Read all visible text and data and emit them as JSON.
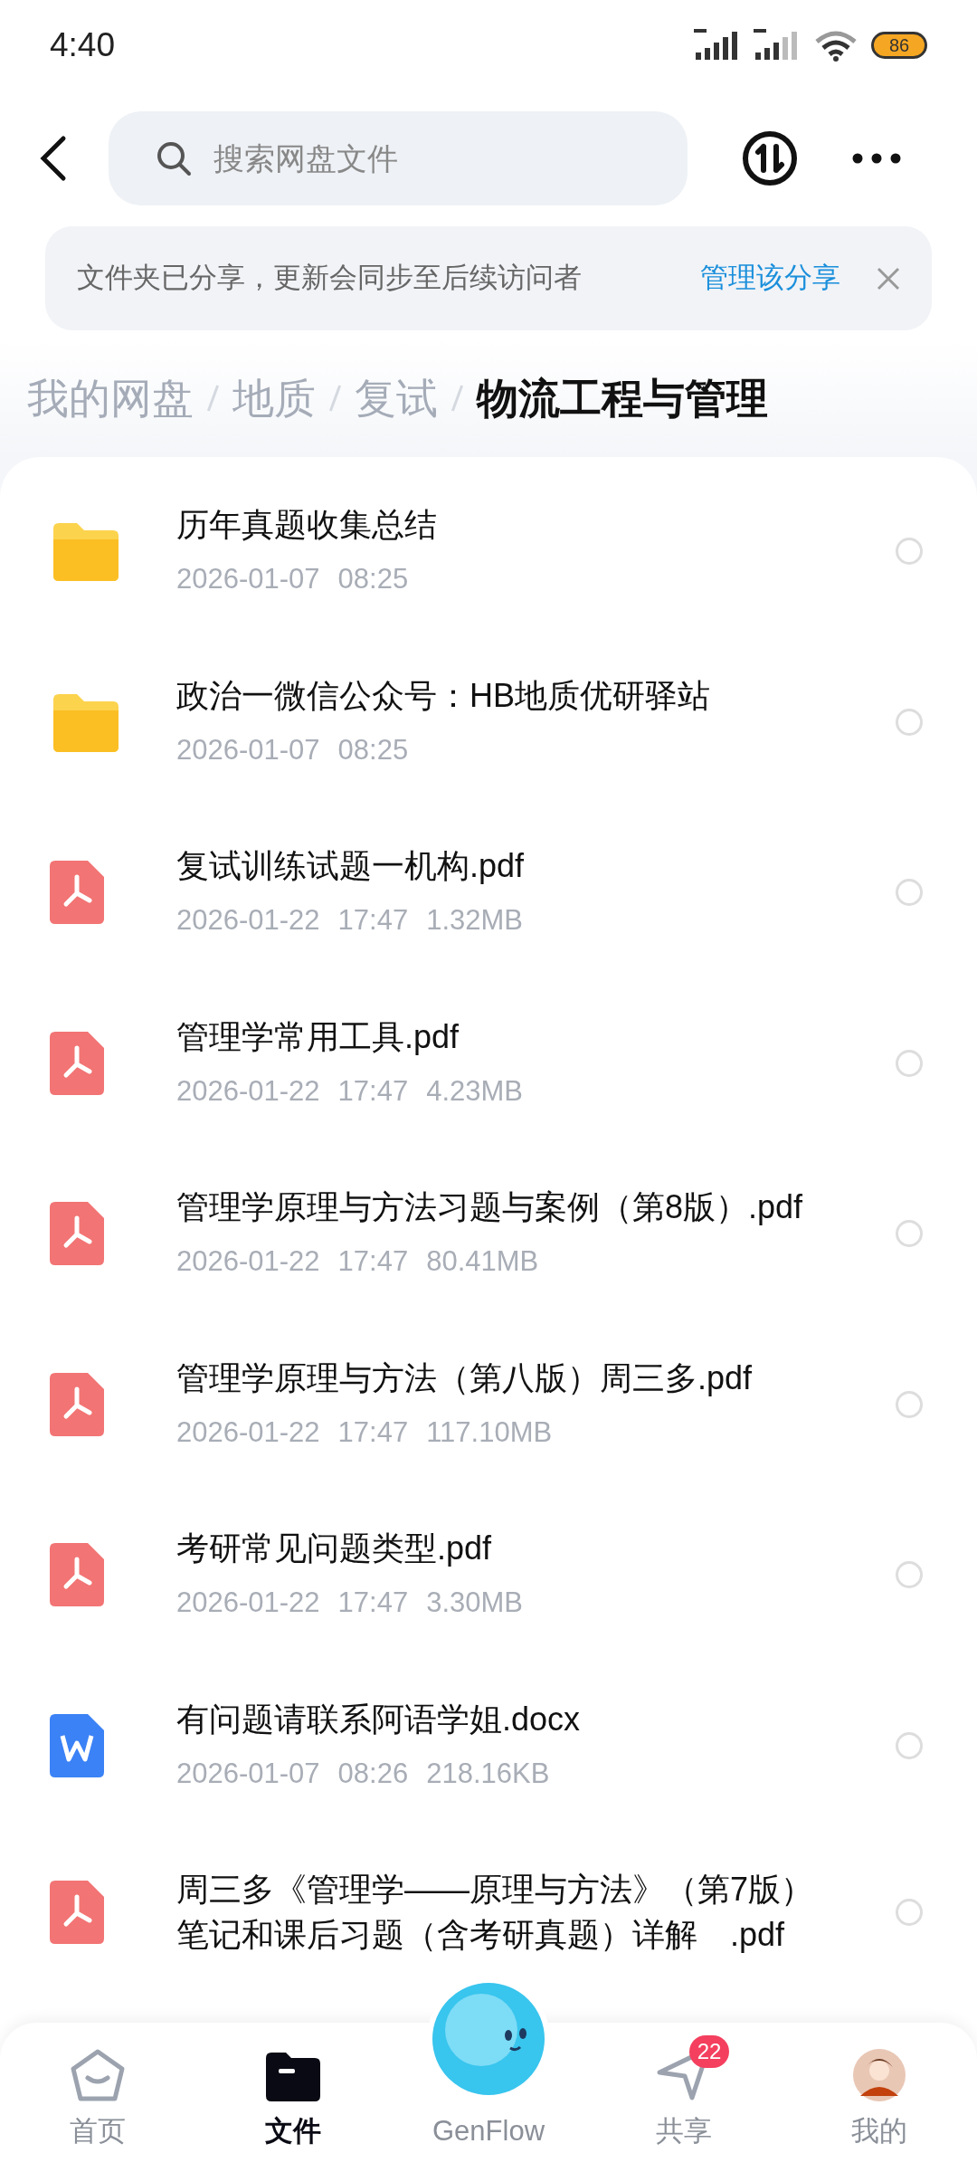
{
  "status_bar": {
    "time": "4:40",
    "battery": "86"
  },
  "header": {
    "search": {
      "placeholder": "搜索网盘文件"
    }
  },
  "banner": {
    "text": "文件夹已分享，更新会同步至后续访问者",
    "link": "管理该分享"
  },
  "breadcrumb": [
    {
      "label": "我的网盘",
      "selected": false
    },
    {
      "label": "地质",
      "selected": false
    },
    {
      "label": "复试",
      "selected": false
    },
    {
      "label": "物流工程与管理",
      "selected": true
    }
  ],
  "files": [
    {
      "kind": "folder",
      "name": "历年真题收集总结",
      "date": "2026-01-07",
      "time": "08:25",
      "checked": false
    },
    {
      "kind": "folder",
      "name": "政治一微信公众号：HB地质优研驿站",
      "date": "2026-01-07",
      "time": "08:25",
      "checked": false
    },
    {
      "kind": "pdf",
      "name": "复试训练试题一机构.pdf",
      "date": "2026-01-22",
      "time": "17:47",
      "size": "1.32MB",
      "checked": false
    },
    {
      "kind": "pdf",
      "name": "管理学常用工具.pdf",
      "date": "2026-01-22",
      "time": "17:47",
      "size": "4.23MB",
      "checked": false
    },
    {
      "kind": "pdf",
      "name": "管理学原理与方法习题与案例（第8版）.pdf",
      "date": "2026-01-22",
      "time": "17:47",
      "size": "80.41MB",
      "checked": false
    },
    {
      "kind": "pdf",
      "name": "管理学原理与方法（第八版）周三多.pdf",
      "date": "2026-01-22",
      "time": "17:47",
      "size": "117.10MB",
      "checked": false
    },
    {
      "kind": "pdf",
      "name": "考研常见问题类型.pdf",
      "date": "2026-01-22",
      "time": "17:47",
      "size": "3.30MB",
      "checked": false
    },
    {
      "kind": "word",
      "name": "有问题请联系阿语学姐.docx",
      "date": "2026-01-07",
      "time": "08:26",
      "size": "218.16KB",
      "checked": false
    },
    {
      "kind": "pdf",
      "name": "周三多《管理学——原理与方法》（第7版）笔记和课后习题（含考研真题）详解　.pdf",
      "checked": false
    }
  ],
  "nav": [
    {
      "kind": "home",
      "label": "首页",
      "selected": false
    },
    {
      "kind": "files",
      "label": "文件",
      "selected": true
    },
    {
      "kind": "genflow",
      "label": "GenFlow",
      "selected": false
    },
    {
      "kind": "share",
      "label": "共享",
      "selected": false,
      "badge": "22"
    },
    {
      "kind": "me",
      "label": "我的",
      "selected": false
    }
  ]
}
